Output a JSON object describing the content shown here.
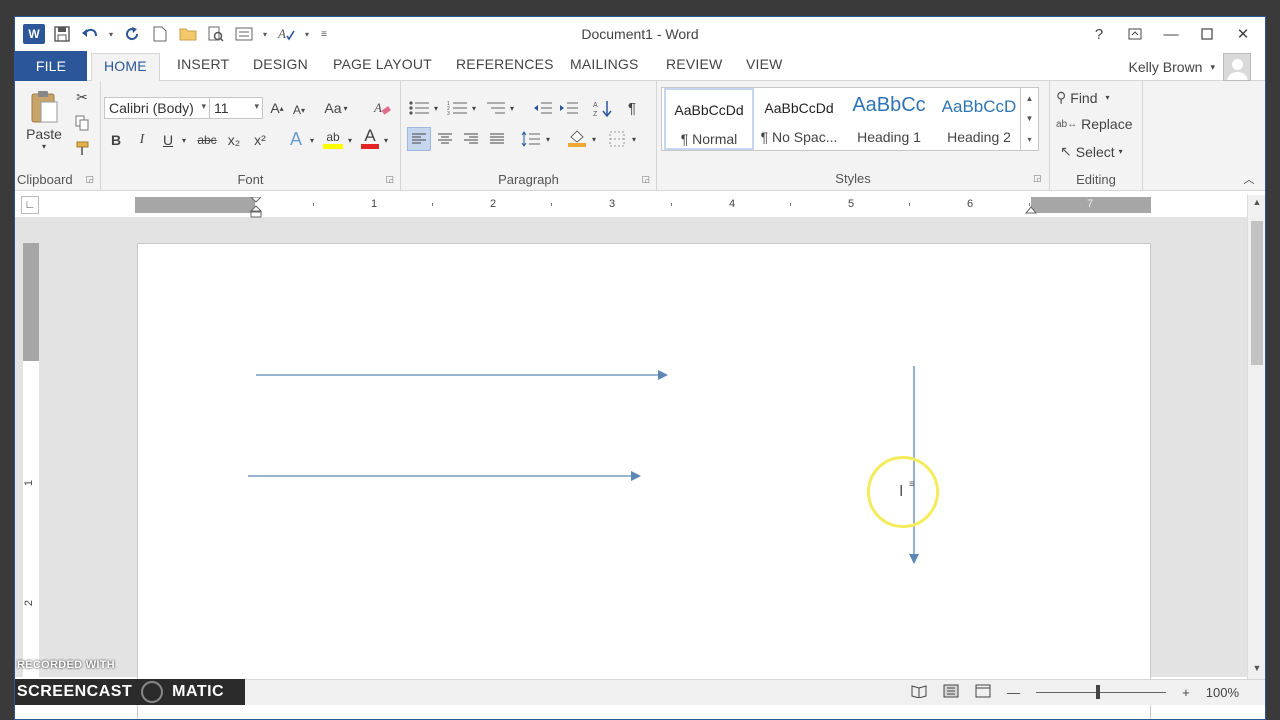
{
  "window": {
    "title": "Document1 - Word",
    "user_name": "Kelly Brown",
    "controls": [
      "?",
      "restore-ribbon",
      "minimize",
      "maximize",
      "close"
    ]
  },
  "tabs": [
    {
      "label": "FILE",
      "key": "file"
    },
    {
      "label": "HOME",
      "key": "home",
      "active": true
    },
    {
      "label": "INSERT",
      "key": "insert"
    },
    {
      "label": "DESIGN",
      "key": "design"
    },
    {
      "label": "PAGE LAYOUT",
      "key": "page-layout"
    },
    {
      "label": "REFERENCES",
      "key": "references"
    },
    {
      "label": "MAILINGS",
      "key": "mailings"
    },
    {
      "label": "REVIEW",
      "key": "review"
    },
    {
      "label": "VIEW",
      "key": "view"
    }
  ],
  "ribbon": {
    "clipboard": {
      "label": "Clipboard",
      "paste": "Paste"
    },
    "font": {
      "label": "Font",
      "font_name": "Calibri (Body)",
      "font_size": "11",
      "grow": "A",
      "shrink": "A",
      "change_case": "Aa",
      "bold": "B",
      "italic": "I",
      "underline": "U",
      "strikethrough": "abc",
      "subscript": "x₂",
      "superscript": "x²",
      "text_effects": "A",
      "highlight": "ab",
      "font_color": "A"
    },
    "paragraph": {
      "label": "Paragraph",
      "show_marks": "¶"
    },
    "styles": {
      "label": "Styles",
      "items": [
        {
          "sample": "AaBbCcDd",
          "name": "¶ Normal",
          "selected": true
        },
        {
          "sample": "AaBbCcDd",
          "name": "¶ No Spac..."
        },
        {
          "sample": "AaBbCc",
          "name": "Heading 1"
        },
        {
          "sample": "AaBbCcD",
          "name": "Heading 2"
        }
      ]
    },
    "editing": {
      "label": "Editing",
      "find": "Find",
      "replace": "Replace",
      "select": "Select"
    }
  },
  "ruler": {
    "numbers": [
      "1",
      "2",
      "3",
      "4",
      "5",
      "6",
      "7"
    ],
    "vertical_numbers": [
      "1",
      "2"
    ]
  },
  "statusbar": {
    "zoom": "100%"
  },
  "watermark": {
    "top": "RECORDED WITH",
    "main": "SCREENCAST",
    "suffix": "MATIC"
  },
  "colors": {
    "accent": "#2b579a",
    "arrow": "#5b86b5",
    "highlight_ring": "#f4ec5c"
  }
}
